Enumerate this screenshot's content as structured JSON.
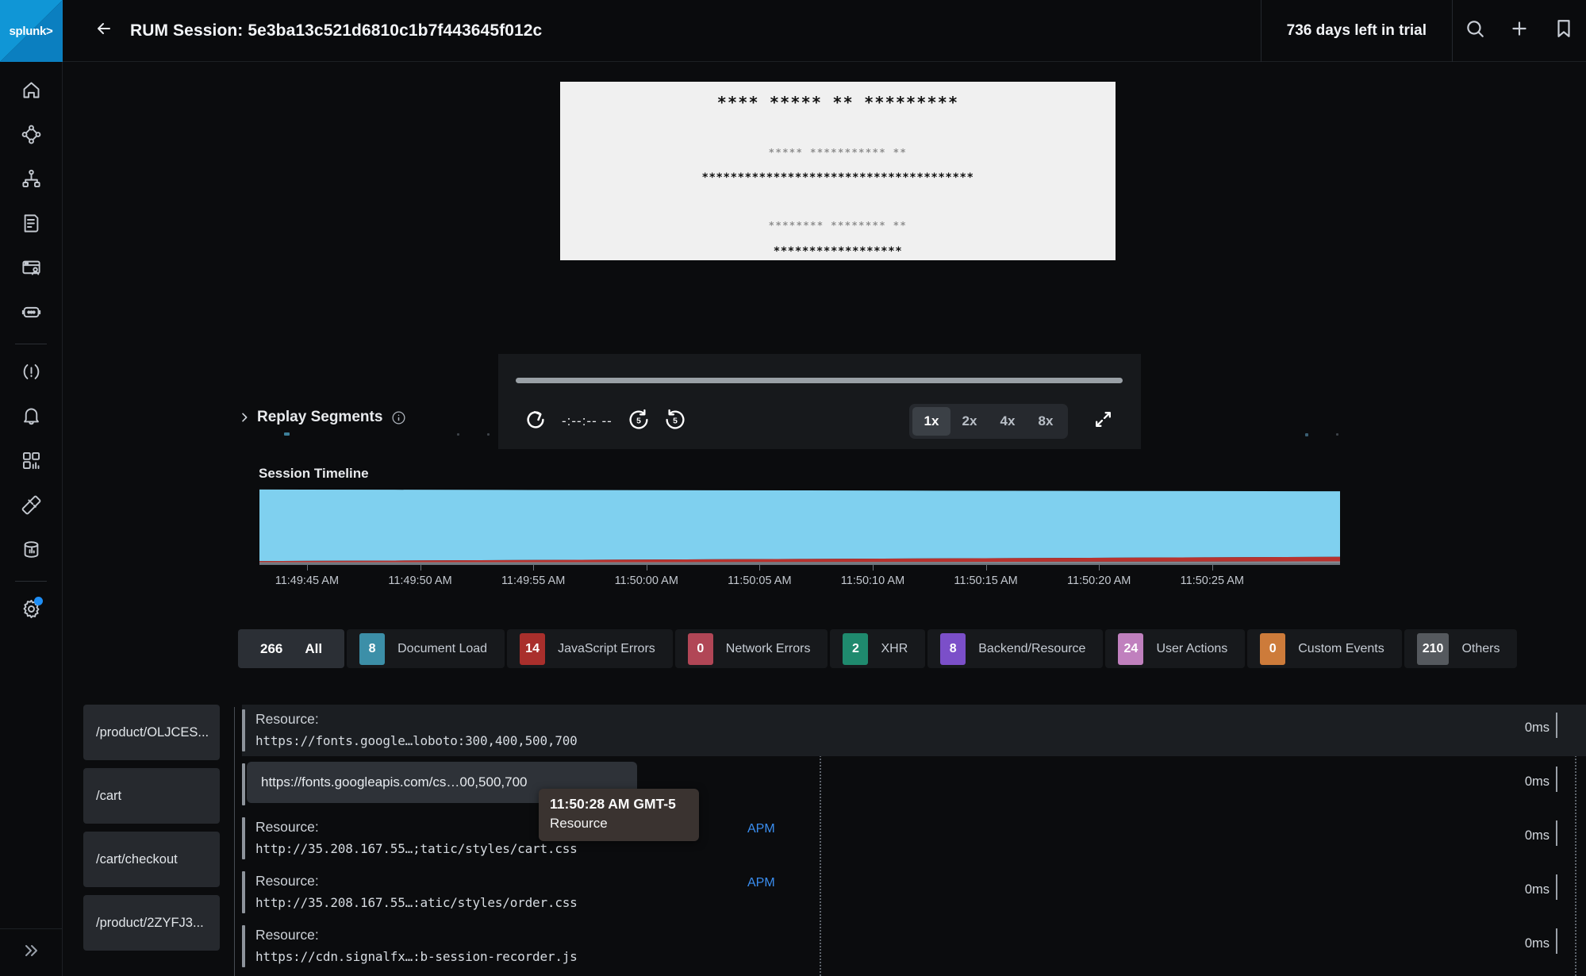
{
  "brand": {
    "name": "splunk>"
  },
  "topbar": {
    "title": "RUM Session: 5e3ba13c521d6810c1b7f443645f012c",
    "back_icon": "arrow-left-icon",
    "trial_text": "736 days left in trial",
    "icons": [
      "search-icon",
      "plus-icon",
      "bookmark-icon"
    ]
  },
  "sidebar": {
    "items": [
      {
        "name": "home",
        "icon": "home-icon"
      },
      {
        "name": "apm",
        "icon": "service-map-icon"
      },
      {
        "name": "infrastructure",
        "icon": "hierarchy-icon"
      },
      {
        "name": "log-observer",
        "icon": "document-icon"
      },
      {
        "name": "rum",
        "icon": "browser-user-icon"
      },
      {
        "name": "synthetics",
        "icon": "robot-icon"
      },
      {
        "name": "incidents",
        "icon": "alert-icon"
      },
      {
        "name": "alerts",
        "icon": "bell-icon"
      },
      {
        "name": "dashboards",
        "icon": "dashboard-icon"
      },
      {
        "name": "metrics",
        "icon": "ruler-icon"
      },
      {
        "name": "data-management",
        "icon": "database-icon"
      },
      {
        "name": "settings",
        "icon": "gear-icon",
        "badge": true
      }
    ],
    "expand_icon": "chevrons-right-icon"
  },
  "player": {
    "masked_lines": [
      "**** ***** ** *********",
      "***** *********** **",
      "**************************************",
      "******** ******** **",
      "******************",
      "******** ****"
    ],
    "time_display": "-:--:-- --",
    "controls": [
      {
        "name": "restart-button",
        "icon": "restart-icon"
      },
      {
        "name": "rewind-5-button",
        "icon": "rewind-5-icon"
      },
      {
        "name": "forward-5-button",
        "icon": "forward-5-icon"
      }
    ],
    "speeds": [
      "1x",
      "2x",
      "4x",
      "8x"
    ],
    "active_speed": "1x",
    "fullscreen_icon": "expand-icon",
    "scrub_progress_pct": 0
  },
  "replay_segments": {
    "label": "Replay Segments",
    "chevron_icon": "chevron-right-icon",
    "info_icon": "info-icon",
    "collapsed": true
  },
  "timeline": {
    "title": "Session Timeline"
  },
  "chart_data": {
    "type": "area",
    "title": "Session Timeline",
    "xlabel": "",
    "ylabel": "",
    "grid": false,
    "legend": "none",
    "x": [
      "11:49:45 AM",
      "11:49:50 AM",
      "11:49:55 AM",
      "11:50:00 AM",
      "11:50:05 AM",
      "11:50:10 AM",
      "11:50:15 AM",
      "11:50:20 AM",
      "11:50:25 AM"
    ],
    "xlim": [
      "11:49:43 AM",
      "11:50:28 AM"
    ],
    "ylim": [
      0,
      100
    ],
    "series": [
      {
        "name": "Document Load",
        "color": "#7fd0ef",
        "values": [
          94,
          93,
          92,
          91,
          90,
          89,
          88,
          87,
          86
        ]
      },
      {
        "name": "JavaScript Errors",
        "color": "#b8332f",
        "values": [
          2,
          2.5,
          3,
          3.5,
          4,
          4.5,
          5,
          5.5,
          6
        ]
      },
      {
        "name": "Others",
        "color": "#8d939b",
        "values": [
          1,
          1.2,
          1.4,
          1.6,
          1.8,
          2,
          2.2,
          2.4,
          2.6
        ]
      }
    ]
  },
  "chips": [
    {
      "count": "266",
      "label": "All",
      "color": "transparent",
      "selected": true
    },
    {
      "count": "8",
      "label": "Document Load",
      "color": "#3c8fa8",
      "selected": false
    },
    {
      "count": "14",
      "label": "JavaScript Errors",
      "color": "#a92f2c",
      "selected": false
    },
    {
      "count": "0",
      "label": "Network Errors",
      "color": "#b14656",
      "selected": false
    },
    {
      "count": "2",
      "label": "XHR",
      "color": "#1f8a6e",
      "selected": false
    },
    {
      "count": "8",
      "label": "Backend/Resource",
      "color": "#7b4fc9",
      "selected": false
    },
    {
      "count": "24",
      "label": "User Actions",
      "color": "#c080be",
      "selected": false
    },
    {
      "count": "0",
      "label": "Custom Events",
      "color": "#cd7b3a",
      "selected": false
    },
    {
      "count": "210",
      "label": "Others",
      "color": "#55595e",
      "selected": false
    }
  ],
  "pages": [
    {
      "label": "/product/OLJCES..."
    },
    {
      "label": "/cart"
    },
    {
      "label": "/cart/checkout"
    },
    {
      "label": "/product/2ZYFJ3..."
    }
  ],
  "waterfall": {
    "rows": [
      {
        "title": "Resource:",
        "url": "https://fonts.google…loboto:300,400,500,700",
        "apm": "",
        "duration": "0ms",
        "hovered": true,
        "pill": false
      },
      {
        "pill": true,
        "pill_text": "https://fonts.googleapis.com/cs…00,500,700",
        "duration": "0ms",
        "apm": ""
      },
      {
        "title": "Resource:",
        "url": "http://35.208.167.55…;tatic/styles/cart.css",
        "apm": "APM",
        "duration": "0ms",
        "hovered": false,
        "pill": false
      },
      {
        "title": "Resource:",
        "url": "http://35.208.167.55…:atic/styles/order.css",
        "apm": "APM",
        "duration": "0ms",
        "hovered": false,
        "pill": false
      },
      {
        "title": "Resource:",
        "url": "https://cdn.signalfx…:b-session-recorder.js",
        "apm": "",
        "duration": "0ms",
        "hovered": false,
        "pill": false
      }
    ]
  },
  "tooltip": {
    "time": "11:50:28 AM GMT-5",
    "type": "Resource"
  }
}
